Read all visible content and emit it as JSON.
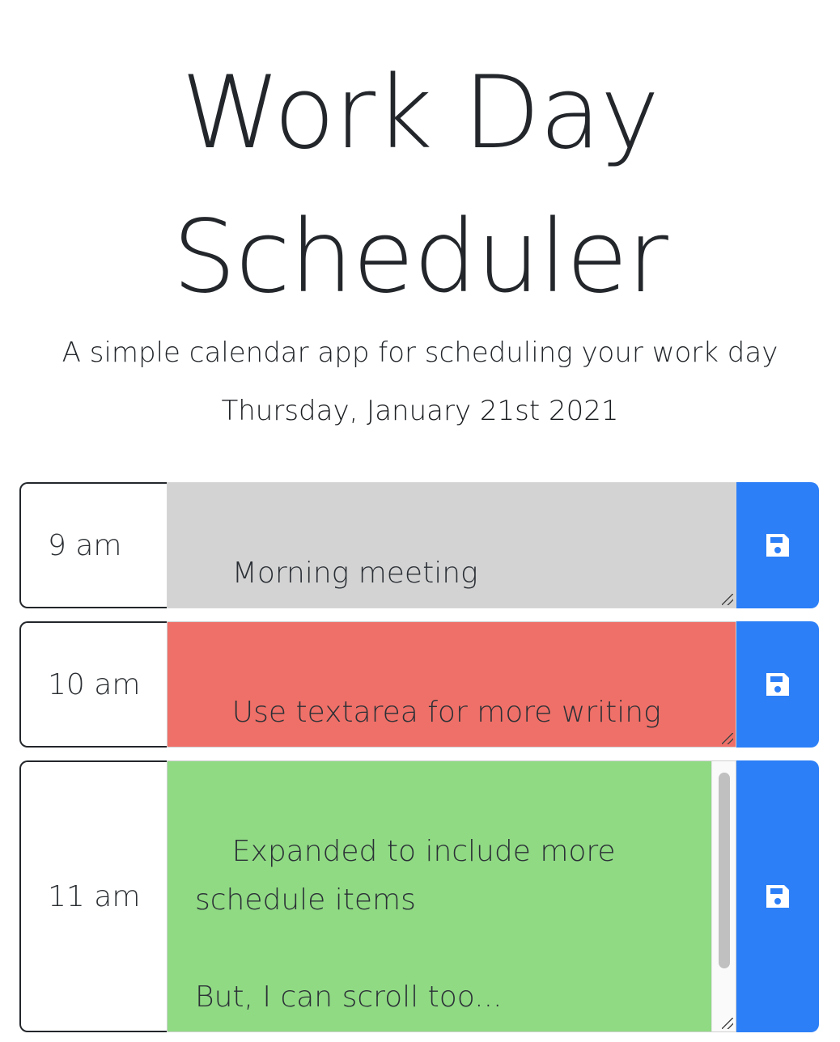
{
  "header": {
    "title_line1": "Work Day",
    "title_line2": "Scheduler",
    "lead": "A simple calendar app for scheduling your work day",
    "current_date": "Thursday, January 21st 2021"
  },
  "timeblocks": [
    {
      "hour": "9 am",
      "text": "Morning meeting",
      "status": "past",
      "save_icon": "floppy-disk-icon"
    },
    {
      "hour": "10 am",
      "text": "Use textarea for more writing\nspace",
      "status": "present",
      "save_icon": "floppy-disk-icon"
    },
    {
      "hour": "11 am",
      "text": "Expanded to include more\nschedule items\n\nBut, I can scroll too...\nsee?!",
      "status": "future",
      "save_icon": "floppy-disk-icon"
    }
  ],
  "colors": {
    "past": "#d3d3d3",
    "present": "#ef7068",
    "future": "#90da84",
    "save_button": "#2c7ff7"
  }
}
